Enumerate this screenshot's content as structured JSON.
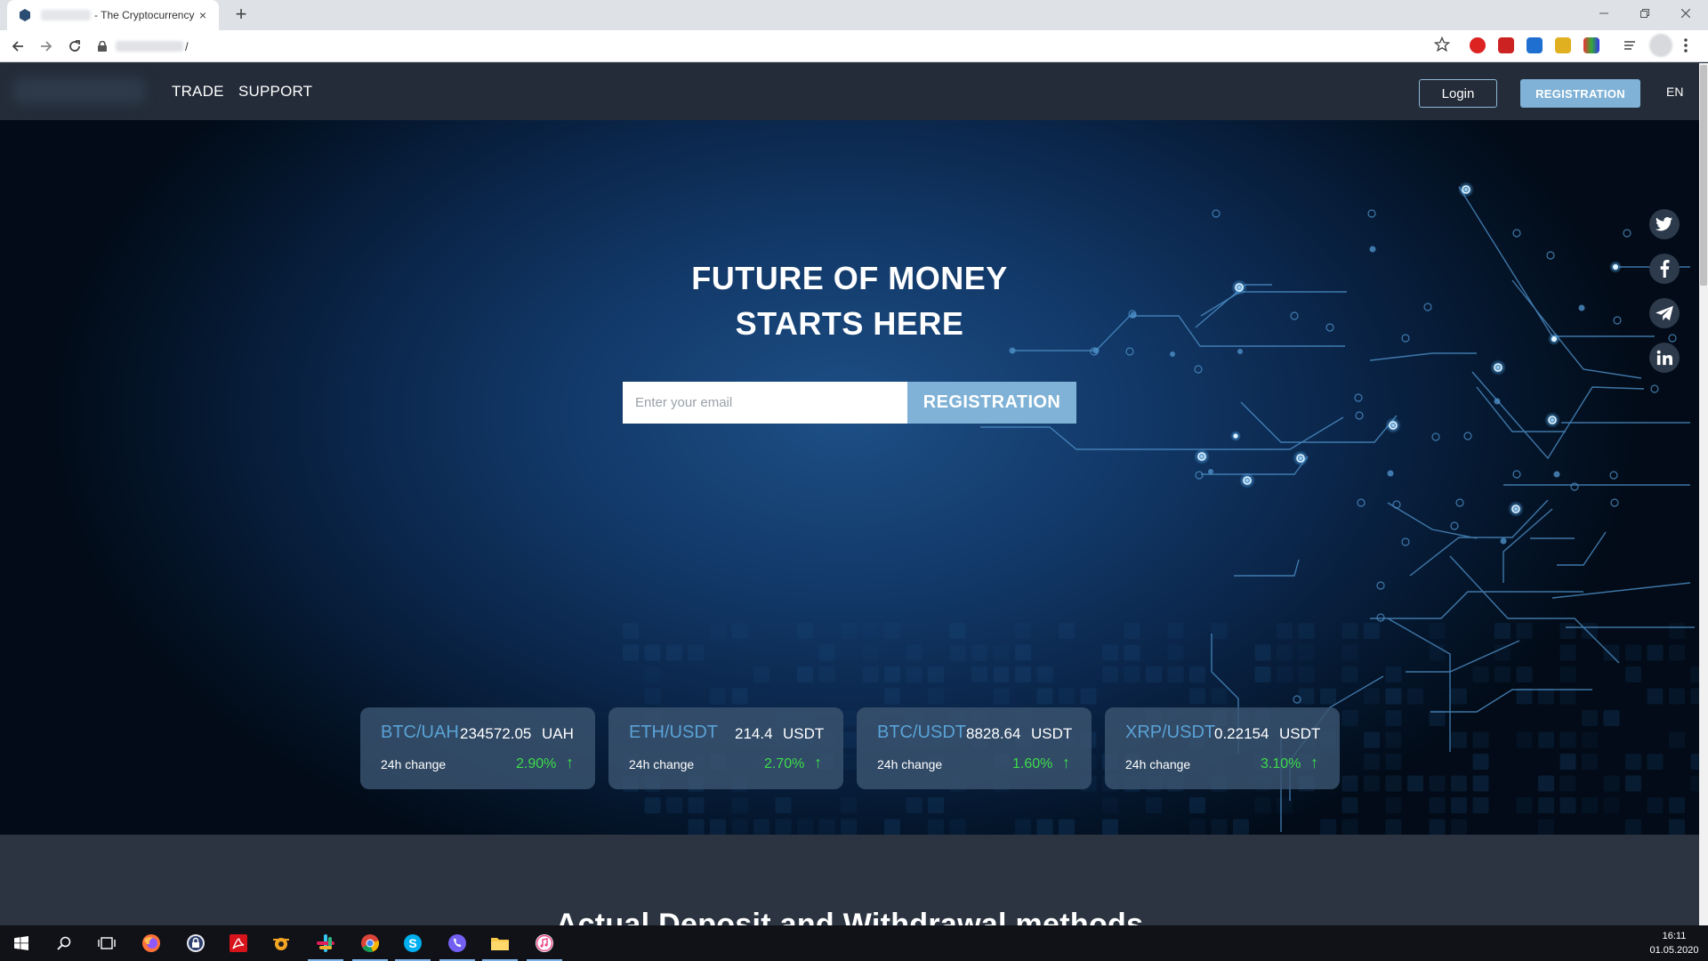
{
  "browser": {
    "tab_title": "- The Cryptocurrency",
    "tab_close": "×",
    "new_tab": "+",
    "url_suffix": "/"
  },
  "site": {
    "nav": {
      "trade": "TRADE",
      "support": "SUPPORT"
    },
    "login": "Login",
    "registration": "REGISTRATION",
    "language": "EN"
  },
  "hero": {
    "title_line1": "FUTURE OF MONEY",
    "title_line2": "STARTS HERE",
    "email_placeholder": "Enter your email",
    "register_button": "REGISTRATION"
  },
  "social": [
    "twitter-icon",
    "facebook-icon",
    "telegram-icon",
    "linkedin-icon"
  ],
  "tickers": [
    {
      "pair": "BTC/UAH",
      "price": "234572.05",
      "unit": "UAH",
      "change_label": "24h change",
      "change": "2.90%",
      "arrow": "↑"
    },
    {
      "pair": "ETH/USDT",
      "price": "214.4",
      "unit": "USDT",
      "change_label": "24h change",
      "change": "2.70%",
      "arrow": "↑"
    },
    {
      "pair": "BTC/USDT",
      "price": "8828.64",
      "unit": "USDT",
      "change_label": "24h change",
      "change": "1.60%",
      "arrow": "↑"
    },
    {
      "pair": "XRP/USDT",
      "price": "0.22154",
      "unit": "USDT",
      "change_label": "24h change",
      "change": "3.10%",
      "arrow": "↑"
    }
  ],
  "section": {
    "title": "Actual Deposit and Withdrawal methods"
  },
  "taskbar": {
    "apps": [
      "windows-start-icon",
      "search-icon",
      "task-view-icon",
      "firefox-icon",
      "keepass-icon",
      "acrobat-icon",
      "paint-icon",
      "slack-icon",
      "chrome-icon",
      "skype-icon",
      "viber-icon",
      "file-explorer-icon",
      "itunes-icon"
    ],
    "time": "16:11",
    "date": "01.05.2020"
  },
  "colors": {
    "accent": "#7fb2d6",
    "positive": "#3ddc4a",
    "header_bg": "#232c38",
    "pair_blue": "#5aa2d6"
  }
}
